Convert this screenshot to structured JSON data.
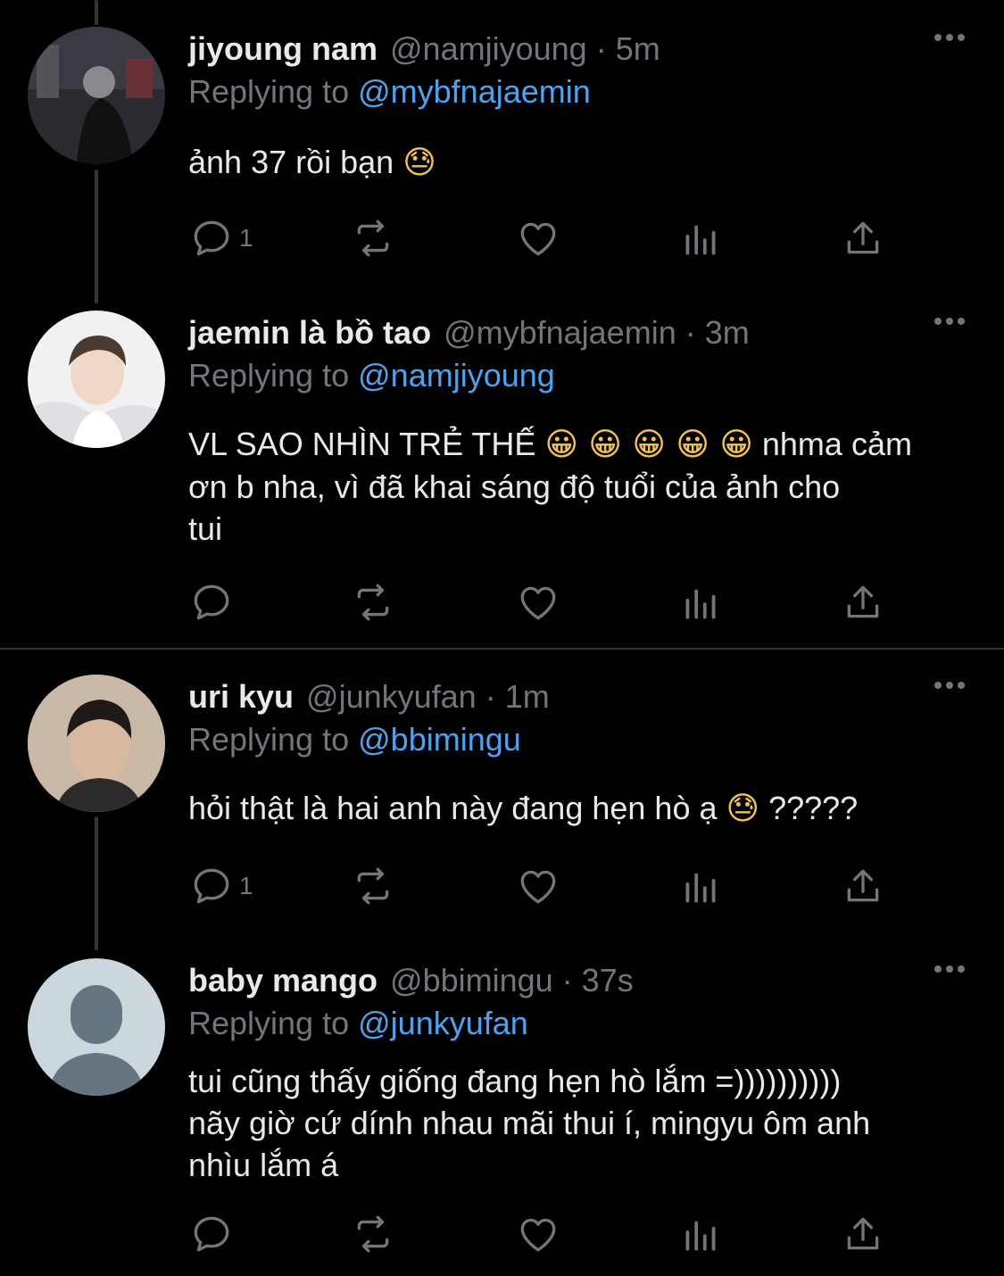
{
  "tweets": [
    {
      "name": "jiyoung nam",
      "handle": "@namjiyoung",
      "time": "5m",
      "replying_prefix": "Replying to",
      "replying_to": "@mybfnajaemin",
      "text": "ảnh 37 rồi bạn",
      "emoji": "😓",
      "reply_count": "1"
    },
    {
      "name": "jaemin là bồ tao",
      "handle": "@mybfnajaemin",
      "time": "3m",
      "replying_prefix": "Replying to",
      "replying_to": "@namjiyoung",
      "text_line1": "VL SAO NHÌN TRẺ THẾ",
      "emoji": "😀 😀 😀 😀 😀",
      "text_line1_end": "nhma cảm",
      "text_line2": "ơn b nha, vì đã khai sáng độ tuổi của ảnh cho",
      "text_line3": "tui",
      "reply_count": ""
    },
    {
      "name": "uri kyu",
      "handle": "@junkyufan",
      "time": "1m",
      "replying_prefix": "Replying to",
      "replying_to": "@bbimingu",
      "text": "hỏi thật là hai anh này đang hẹn hò ạ",
      "emoji": "😓",
      "text_end": "?????",
      "reply_count": "1"
    },
    {
      "name": "baby mango",
      "handle": "@bbimingu",
      "time": "37s",
      "replying_prefix": "Replying to",
      "replying_to": "@junkyufan",
      "text_line1": "tui cũng thấy giống đang hẹn hò lắm =))))))))))",
      "text_line2": "nãy giờ cứ dính nhau mãi thui í, mingyu ôm anh",
      "text_line3": "nhìu lắm á",
      "reply_count": ""
    }
  ],
  "dot_separator": "·",
  "colors": {
    "background": "#000000",
    "text": "#e7e9ea",
    "muted": "#71767b",
    "link": "#4da3ee",
    "line": "#333639"
  },
  "icons": [
    "reply-icon",
    "retweet-icon",
    "like-icon",
    "analytics-icon",
    "share-icon",
    "more-icon"
  ]
}
